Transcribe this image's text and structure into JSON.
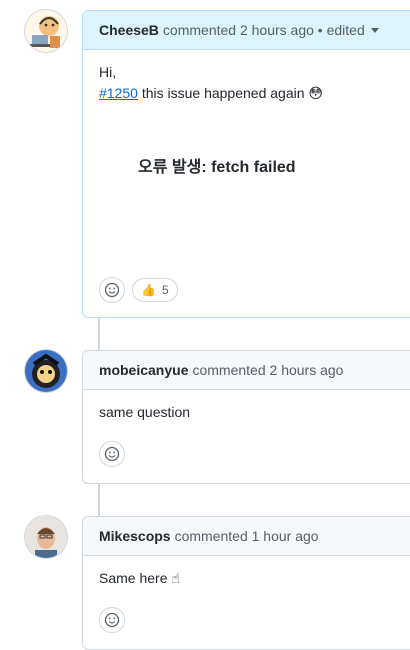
{
  "comments": [
    {
      "author": "CheeseB",
      "meta": "commented 2 hours ago • edited",
      "line1": "Hi,",
      "link": "#1250",
      "line2": " this issue happened again ",
      "emoji": "😳",
      "big_text": "오류 발생: fetch failed",
      "reaction": {
        "emoji": "👍",
        "count": "5"
      }
    },
    {
      "author": "mobeicanyue",
      "meta": "commented 2 hours ago",
      "body": "same question"
    },
    {
      "author": "Mikescops",
      "meta": "commented 1 hour ago",
      "body": "Same here ",
      "emoji": "☝"
    }
  ]
}
